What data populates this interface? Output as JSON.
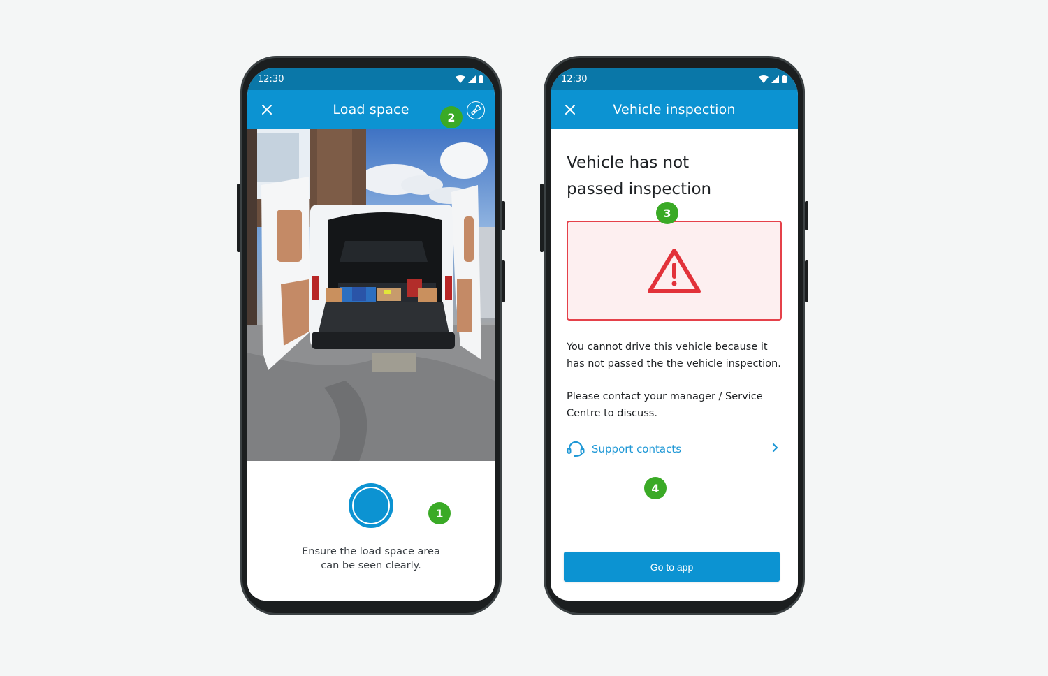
{
  "left_phone": {
    "status_bar": {
      "time": "12:30",
      "icons": [
        "wifi-icon",
        "signal-icon",
        "battery-icon"
      ]
    },
    "app_bar": {
      "title": "Load space",
      "close_icon": "close-icon",
      "action_icon": "flashlight-icon"
    },
    "photo": {
      "subject": "Open rear of white van showing load space"
    },
    "capture": {
      "hint_line1": "Ensure the load space area",
      "hint_line2": "can be seen clearly."
    },
    "badges": {
      "shutter": "1",
      "flashlight": "2"
    }
  },
  "right_phone": {
    "status_bar": {
      "time": "12:30",
      "icons": [
        "wifi-icon",
        "signal-icon",
        "battery-icon"
      ]
    },
    "app_bar": {
      "title": "Vehicle inspection",
      "close_icon": "close-icon"
    },
    "heading": "Vehicle has not passed inspection",
    "alert_icon": "warning-triangle-icon",
    "message_1": "You cannot drive this vehicle because it has not passed the the vehicle inspection.",
    "message_2": "Please contact your manager / Service Centre to discuss.",
    "support_link": {
      "label": "Support contacts",
      "icon": "headset-icon",
      "trailing_icon": "chevron-right-icon"
    },
    "primary_button": "Go to app",
    "badges": {
      "heading": "3",
      "support": "4"
    }
  },
  "colors": {
    "status_bar": "#0a77a8",
    "app_bar": "#0c93d2",
    "badge": "#3aaa26",
    "alert_border": "#e5414a",
    "alert_bg": "#fdeff0",
    "link": "#1f98d6",
    "background": "#f4f6f6"
  }
}
